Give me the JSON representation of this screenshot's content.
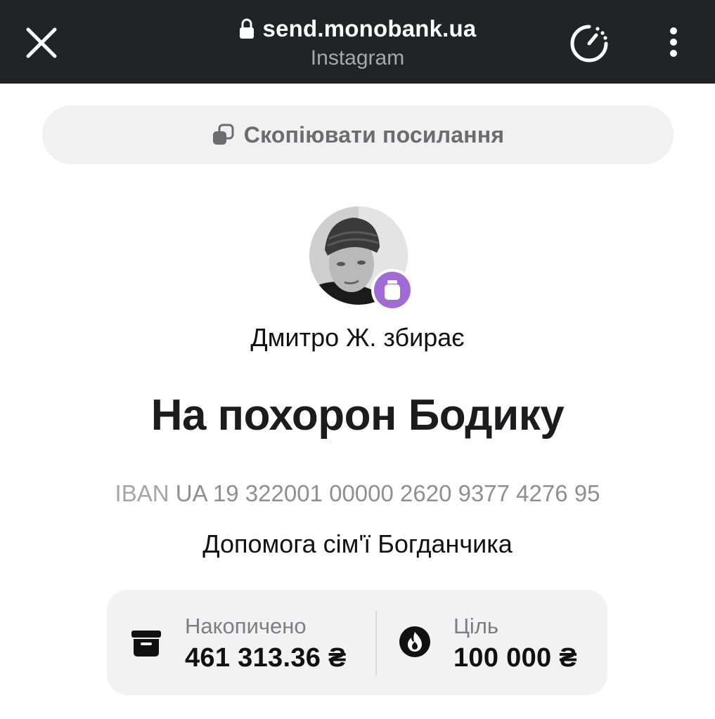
{
  "browser": {
    "url": "send.monobank.ua",
    "source": "Instagram"
  },
  "copy_link": {
    "label": "Скопіювати посилання"
  },
  "jar": {
    "collector_text": "Дмитро Ж. збирає",
    "title": "На похорон Бодику",
    "iban_label": "IBAN",
    "iban_value": "UA 19 322001 00000 2620 9377 4276 95",
    "description": "Допомога сім'ї Богданчика"
  },
  "stats": {
    "collected_label": "Накопичено",
    "collected_value": "461 313.36 ₴",
    "goal_label": "Ціль",
    "goal_value": "100 000 ₴"
  },
  "icons": {
    "close": "close-icon",
    "lock": "lock-icon",
    "timer": "timer-icon",
    "more": "more-vertical-icon",
    "copy": "copy-icon",
    "jar_badge": "jar-icon",
    "collected": "archive-box-icon",
    "goal": "fire-icon"
  },
  "colors": {
    "topbar": "#222326",
    "badge": "#a16bd6",
    "pill_bg": "#f1f1f2",
    "card_bg": "#f2f2f3"
  }
}
